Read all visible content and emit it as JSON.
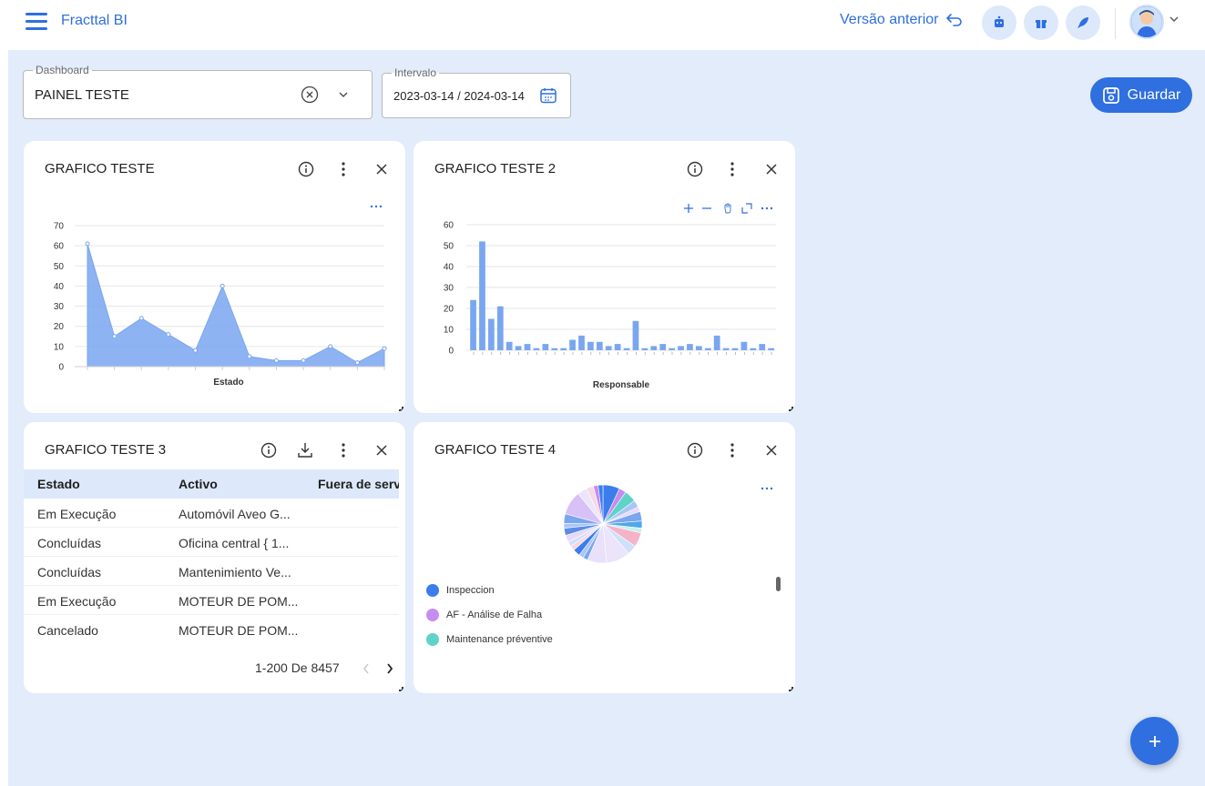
{
  "header": {
    "brand": "Fracttal BI",
    "prev_version_label": "Versão anterior"
  },
  "filters": {
    "dashboard": {
      "label": "Dashboard",
      "value": "PAINEL TESTE"
    },
    "interval": {
      "label": "Intervalo",
      "value": "2023-03-14 / 2024-03-14"
    }
  },
  "save_label": "Guardar",
  "cards": [
    {
      "title": "GRAFICO TESTE"
    },
    {
      "title": "GRAFICO TESTE 2"
    },
    {
      "title": "GRAFICO TESTE 3"
    },
    {
      "title": "GRAFICO TESTE 4"
    }
  ],
  "chart_data": [
    {
      "type": "area",
      "title": "",
      "xlabel": "Estado",
      "ylabel": "",
      "ylim": [
        0,
        70
      ],
      "yticks": [
        0,
        10,
        20,
        30,
        40,
        50,
        60,
        70
      ],
      "values": [
        61,
        15,
        24,
        16,
        8,
        40,
        5,
        3,
        3,
        10,
        2,
        9
      ],
      "color": "#7aa6f0"
    },
    {
      "type": "bar",
      "title": "",
      "xlabel": "Responsable",
      "ylabel": "",
      "ylim": [
        0,
        60
      ],
      "yticks": [
        0,
        10,
        20,
        30,
        40,
        50,
        60
      ],
      "values": [
        24,
        52,
        15,
        21,
        4,
        2,
        3,
        1,
        3,
        1,
        1,
        5,
        7,
        4,
        4,
        2,
        3,
        1,
        14,
        1,
        2,
        3,
        1,
        2,
        3,
        2,
        1,
        7,
        1,
        1,
        4,
        1,
        3,
        1
      ],
      "color": "#7aa6f0"
    },
    {
      "type": "table",
      "columns": [
        "Estado",
        "Activo",
        "Fuera de servi"
      ],
      "rows": [
        [
          "Em Execução",
          "Automóvil Aveo G...",
          ""
        ],
        [
          "Concluídas",
          "Oficina central { 1...",
          ""
        ],
        [
          "Concluídas",
          "Mantenimiento Ve...",
          ""
        ],
        [
          "Em Execução",
          "MOTEUR DE POM...",
          ""
        ],
        [
          "Cancelado",
          "MOTEUR DE POM...",
          ""
        ]
      ],
      "pagination": "1-200 De 8457"
    },
    {
      "type": "pie",
      "title": "",
      "legend": [
        {
          "name": "Inspeccion",
          "color": "#3b7ded"
        },
        {
          "name": "AF - Análise de Falha",
          "color": "#c58cf2"
        },
        {
          "name": "Maintenance préventive",
          "color": "#5fd3c8"
        }
      ],
      "values": [
        7,
        3,
        5,
        3,
        2,
        4,
        3,
        2,
        6,
        4,
        10,
        8,
        2,
        2,
        3,
        2,
        2,
        3,
        3,
        2,
        4,
        10,
        4,
        3,
        2,
        2
      ],
      "colors": [
        "#3b7ded",
        "#c58cf2",
        "#5fd3c8",
        "#a9c6f5",
        "#e6d9fb",
        "#7aa6f0",
        "#4fa8e8",
        "#c9f0ec",
        "#f5b3c8",
        "#cfe0fb",
        "#ece4fb",
        "#e9e0fa",
        "#7aa6f0",
        "#a9c6f5",
        "#3b7ded",
        "#f7d6e0",
        "#cfe0fb",
        "#e6d9fb",
        "#5b8de8",
        "#a9c6f5",
        "#7aa6f0",
        "#d8c1f7",
        "#ece4fb",
        "#f5d9e6",
        "#c58cf2",
        "#3b7ded"
      ]
    }
  ]
}
